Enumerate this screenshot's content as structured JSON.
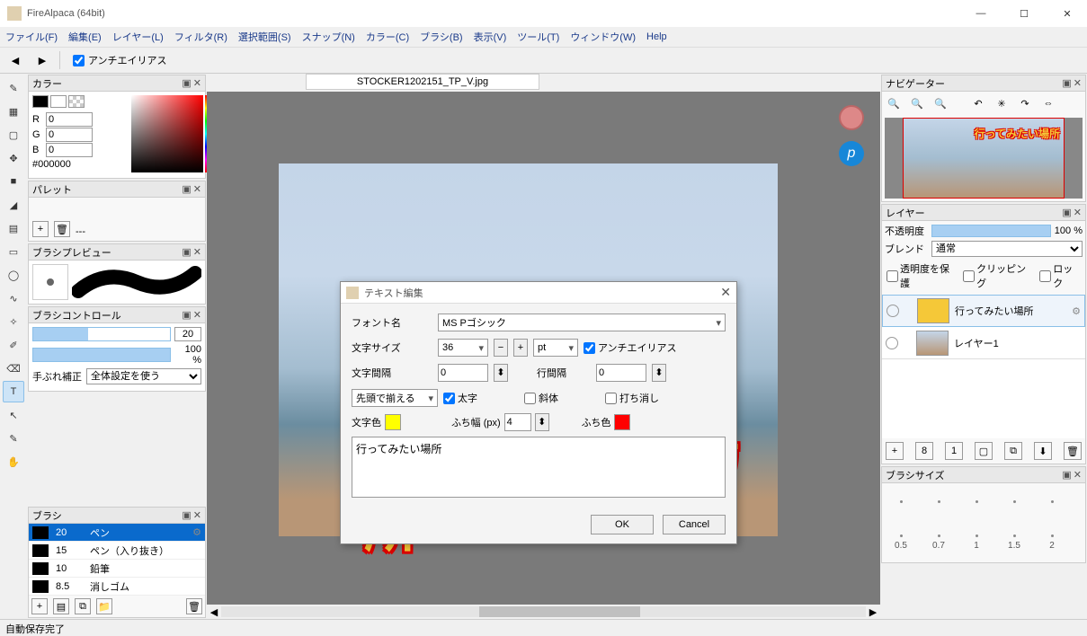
{
  "titlebar": {
    "title": "FireAlpaca (64bit)"
  },
  "menubar": [
    "ファイル(F)",
    "編集(E)",
    "レイヤー(L)",
    "フィルタ(R)",
    "選択範囲(S)",
    "スナップ(N)",
    "カラー(C)",
    "ブラシ(B)",
    "表示(V)",
    "ツール(T)",
    "ウィンドウ(W)",
    "Help"
  ],
  "toolrow": {
    "antialias": "アンチエイリアス"
  },
  "panels": {
    "color": {
      "title": "カラー",
      "r": "0",
      "g": "0",
      "b": "0",
      "hex": "#000000",
      "r_label": "R",
      "g_label": "G",
      "b_label": "B"
    },
    "palette": {
      "title": "パレット",
      "dash": "---"
    },
    "brushprev": {
      "title": "ブラシプレビュー"
    },
    "brushctrl": {
      "title": "ブラシコントロール",
      "size": "20",
      "opacity": "100 %",
      "shake_label": "手ぶれ補正",
      "shake_value": "全体設定を使う"
    },
    "brush": {
      "title": "ブラシ",
      "items": [
        {
          "size": "20",
          "name": "ペン",
          "sel": true
        },
        {
          "size": "15",
          "name": "ペン（入り抜き）"
        },
        {
          "size": "10",
          "name": "鉛筆"
        },
        {
          "size": "8.5",
          "name": "消しゴム"
        }
      ]
    },
    "navigator": {
      "title": "ナビゲーター",
      "preview_text": "行ってみたい場所"
    },
    "layer": {
      "title": "レイヤー",
      "opacity_label": "不透明度",
      "opacity": "100 %",
      "blend_label": "ブレンド",
      "blend_value": "通常",
      "chk_protect": "透明度を保護",
      "chk_clip": "クリッピング",
      "chk_lock": "ロック",
      "items": [
        {
          "name": "行ってみたい場所",
          "sel": true,
          "thumb": "text"
        },
        {
          "name": "レイヤー1",
          "thumb": "img"
        }
      ]
    },
    "brushsize": {
      "title": "ブラシサイズ",
      "sizes": [
        "0.5",
        "0.7",
        "1",
        "1.5",
        "2"
      ]
    }
  },
  "doc": {
    "tab": "STOCKER1202151_TP_V.jpg",
    "text": "行ってみたい場所"
  },
  "modal": {
    "title": "テキスト編集",
    "font_label": "フォント名",
    "font_value": "MS Pゴシック",
    "size_label": "文字サイズ",
    "size_value": "36",
    "size_unit": "pt",
    "aa_label": "アンチエイリアス",
    "charsp_label": "文字間隔",
    "charsp_value": "0",
    "linesp_label": "行間隔",
    "linesp_value": "0",
    "align_value": "先頭で揃える",
    "bold_label": "太字",
    "italic_label": "斜体",
    "strike_label": "打ち消し",
    "textcolor_label": "文字色",
    "textcolor": "#ffff00",
    "edgewidth_label": "ふち幅 (px)",
    "edgewidth_value": "4",
    "edgecolor_label": "ふち色",
    "edgecolor": "#ff0000",
    "text_content": "行ってみたい場所",
    "ok": "OK",
    "cancel": "Cancel"
  },
  "status": "自動保存完了"
}
